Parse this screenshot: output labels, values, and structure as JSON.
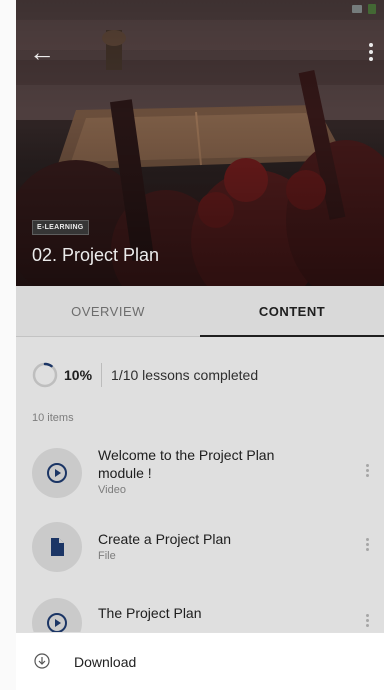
{
  "header": {
    "badge": "E-LEARNING",
    "title": "02. Project Plan"
  },
  "tabs": [
    {
      "label": "OVERVIEW",
      "active": false
    },
    {
      "label": "CONTENT",
      "active": true
    }
  ],
  "progress": {
    "percent_label": "10%",
    "fraction": 0.1,
    "lessons_label": "1/10 lessons completed"
  },
  "items_count": "10 items",
  "items": [
    {
      "title": "Welcome to the Project Plan module !",
      "subtitle": "Video",
      "icon": "play-icon"
    },
    {
      "title": "Create a Project Plan",
      "subtitle": "File",
      "icon": "file-icon"
    },
    {
      "title": "The Project Plan",
      "subtitle": "",
      "icon": "play-icon"
    }
  ],
  "bottom_sheet": {
    "download_label": "Download",
    "icon": "download-icon"
  },
  "colors": {
    "accent": "#1e3a6e",
    "tab_indicator": "#222222"
  }
}
